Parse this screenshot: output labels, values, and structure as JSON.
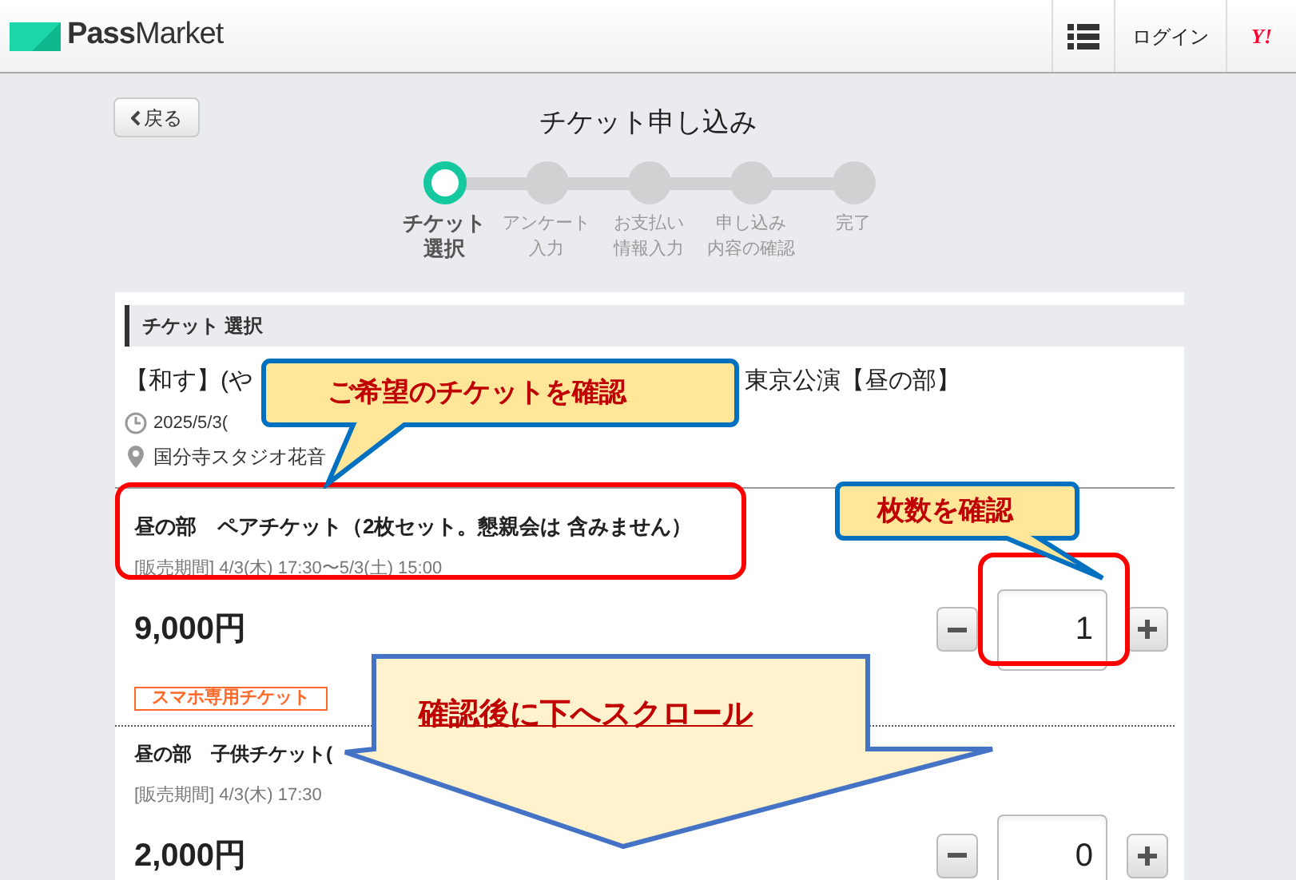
{
  "header": {
    "logo": "**Pass**Market",
    "login": "ログイン",
    "yahoo": "Y!"
  },
  "back_button": "戻る",
  "page_title": "チケット申し込み",
  "steps": [
    {
      "label": [
        "チケット",
        "選択"
      ],
      "selected": true
    },
    {
      "label": [
        "アンケート",
        "入力"
      ],
      "selected": false
    },
    {
      "label": [
        "お支払い",
        "情報入力"
      ],
      "selected": false
    },
    {
      "label": [
        "申し込み",
        "内容の確認"
      ],
      "selected": false
    },
    {
      "label": [
        "完了"
      ],
      "selected": false
    }
  ],
  "section_title": "チケット 選択",
  "event": {
    "title_start": "【和す】(や",
    "title_end": "東京公演【昼の部】",
    "date": "2025/5/3(",
    "venue": "国分寺スタジオ花音"
  },
  "tickets": [
    {
      "name": "昼の部　ペアチケット（2枚セット。懇親会は 含みません）",
      "period": "[販売期間] 4/3(木) 17:30〜5/3(土) 15:00",
      "price": "9,000円",
      "quantity": "1",
      "tag": "スマホ専用チケット"
    },
    {
      "name": "昼の部　子供チケット(",
      "period": "[販売期間] 4/3(木) 17:30",
      "price": "2,000円",
      "quantity": "0"
    }
  ],
  "callouts": [
    {
      "text": "ご希望のチケットを確認"
    },
    {
      "text": "枚数を確認"
    }
  ],
  "arrow": {
    "text": "確認後に下へスクロール"
  }
}
